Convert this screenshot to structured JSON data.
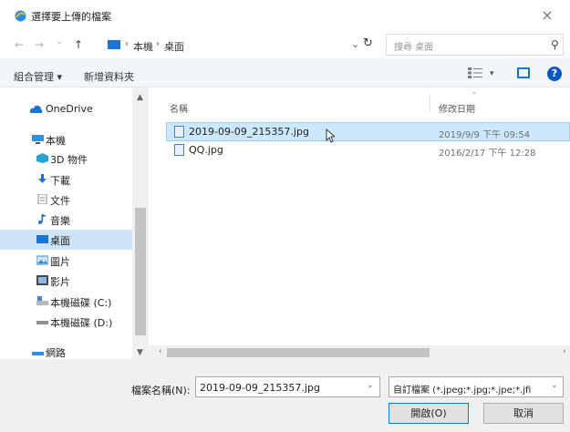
{
  "dialog": {
    "title": "選擇要上傳的檔案",
    "close_glyph": "×"
  },
  "address": {
    "back_glyph": "←",
    "forward_glyph": "→",
    "recent_glyph": "⌄",
    "up_glyph": "↑",
    "crumbs": [
      "本機",
      "桌面"
    ],
    "sep_glyph": "›",
    "dropdown_glyph": "⌄",
    "refresh_glyph": "↻",
    "search_placeholder": "搜尋 桌面",
    "search_glyph": "⚲"
  },
  "toolbar": {
    "organize_label": "組合管理 ▾",
    "new_folder_label": "新增資料夾",
    "view_dropdown_glyph": "▾",
    "help_glyph": "?"
  },
  "nav": {
    "items": [
      {
        "label": "OneDrive",
        "icon": "cloud-icon",
        "color": "#1a74d4"
      },
      {
        "label": "本機",
        "icon": "computer-icon",
        "color": "#2f8fd8"
      },
      {
        "label": "3D 物件",
        "icon": "cube-icon",
        "color": "#2aa0d4"
      },
      {
        "label": "下載",
        "icon": "download-icon",
        "color": "#1a74d4"
      },
      {
        "label": "文件",
        "icon": "document-icon",
        "color": "#8a8a8a"
      },
      {
        "label": "音樂",
        "icon": "music-icon",
        "color": "#1a74d4"
      },
      {
        "label": "桌面",
        "icon": "desktop-icon",
        "color": "#1a74d4"
      },
      {
        "label": "圖片",
        "icon": "pictures-icon",
        "color": "#3d8bd0"
      },
      {
        "label": "影片",
        "icon": "video-icon",
        "color": "#4a4a4a"
      },
      {
        "label": "本機磁碟 (C:)",
        "icon": "drive-c-icon",
        "color": "#4b87c5"
      },
      {
        "label": "本機磁碟 (D:)",
        "icon": "drive-d-icon",
        "color": "#6b6b6b"
      },
      {
        "label": "網路",
        "icon": "network-icon",
        "color": "#2f8fd8"
      }
    ],
    "scroll_up_glyph": "▲",
    "scroll_down_glyph": "▼"
  },
  "files": {
    "columns": [
      "名稱",
      "修改日期"
    ],
    "sort_glyph": "⌄",
    "rows": [
      {
        "name": "2019-09-09_215357.jpg",
        "date": "2019/9/9 下午 09:54"
      },
      {
        "name": "QQ.jpg",
        "date": "2016/2/17 下午 12:28"
      }
    ],
    "scroll_left_glyph": "‹",
    "scroll_right_glyph": "›"
  },
  "footer": {
    "filename_label": "檔案名稱(N):",
    "filename_value": "2019-09-09_215357.jpg",
    "dropdown_glyph": "⌄",
    "filetype_value": "自訂檔案 (*.jpeg;*.jpg;*.jpe;*.jfi",
    "open_label": "開啟(O)",
    "cancel_label": "取消"
  },
  "colors": {
    "accent": "#0078d7",
    "selection": "#cce8ff",
    "toolbar_bg": "#f2f6fb"
  }
}
